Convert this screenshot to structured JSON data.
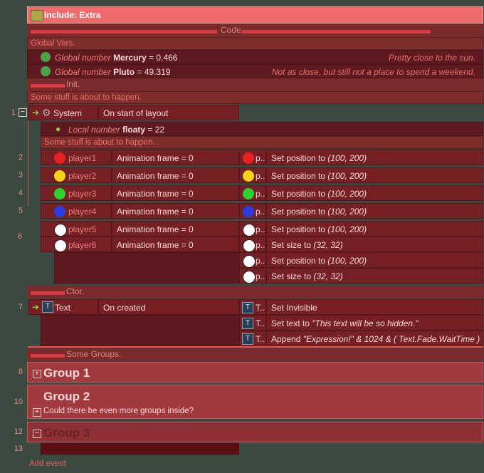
{
  "title": "Include: Extra",
  "sections": {
    "code": "Code",
    "global_vars": "Global Vars.",
    "init": "Init.",
    "init_comment": "Some stuff is about to happen.",
    "inner_comment": "Some stuff is about to happen.",
    "ctor": "Ctor.",
    "groups": "Some Groups."
  },
  "globals": [
    {
      "kind": "Global number",
      "name": "Mercury",
      "value": "= 0.466",
      "comment": "Pretty close to the sun."
    },
    {
      "kind": "Global number",
      "name": "Pluto",
      "value": "= 49.319",
      "comment": "Not as close, but still not a place to spend a weekend."
    }
  ],
  "event1": {
    "num": "1",
    "object": "System",
    "condition": "On start of layout"
  },
  "local": {
    "kind": "Local number",
    "name": "floaty",
    "value": "= 22"
  },
  "players": [
    {
      "num": "2",
      "name": "player1",
      "cond": "Animation frame = 0",
      "act_obj": "p...",
      "act": "Set position to ",
      "arg": "(100, 200)",
      "color": "#e8231f"
    },
    {
      "num": "3",
      "name": "player2",
      "cond": "Animation frame = 0",
      "act_obj": "p...",
      "act": "Set position to ",
      "arg": "(100, 200)",
      "color": "#f3d21b"
    },
    {
      "num": "4",
      "name": "player3",
      "cond": "Animation frame = 0",
      "act_obj": "p...",
      "act": "Set position to ",
      "arg": "(100, 200)",
      "color": "#2fd12f"
    },
    {
      "num": "5",
      "name": "player4",
      "cond": "Animation frame = 0",
      "act_obj": "p...",
      "act": "Set position to ",
      "arg": "(100, 200)",
      "color": "#2b3ce0"
    }
  ],
  "event6": {
    "num": "6",
    "conds": [
      {
        "name": "player5",
        "cond": "Animation frame = 0"
      },
      {
        "name": "player6",
        "cond": "Animation frame = 0"
      }
    ],
    "actions": [
      {
        "obj": "p...",
        "act": "Set position to ",
        "arg": "(100, 200)"
      },
      {
        "obj": "p...",
        "act": "Set size to ",
        "arg": "(32, 32)"
      },
      {
        "obj": "p...",
        "act": "Set position to ",
        "arg": "(100, 200)"
      },
      {
        "obj": "p...",
        "act": "Set size to ",
        "arg": "(32, 32)"
      }
    ]
  },
  "event7": {
    "num": "7",
    "object": "Text",
    "condition": "On created",
    "actions": [
      {
        "obj": "T...",
        "act": "Set Invisible",
        "arg": ""
      },
      {
        "obj": "T...",
        "act": "Set text to ",
        "arg": "\"This text will be so hidden.\""
      },
      {
        "obj": "T...",
        "act": "Append ",
        "arg": "\"Expression!\" & 1024 & ( Text.Fade.WaitTime )"
      }
    ]
  },
  "groups": [
    {
      "num": "8",
      "title": "Group 1"
    },
    {
      "num": "10",
      "title": "Group 2",
      "desc": "Could there be even more groups inside?"
    },
    {
      "num": "12",
      "title": "Group 3"
    }
  ],
  "event13": {
    "num": "13"
  },
  "add_event": "Add event",
  "colors": {
    "background": "#3a4a41",
    "title": "#ef6b6b",
    "event": "#742025",
    "group": "#a03a3f"
  }
}
